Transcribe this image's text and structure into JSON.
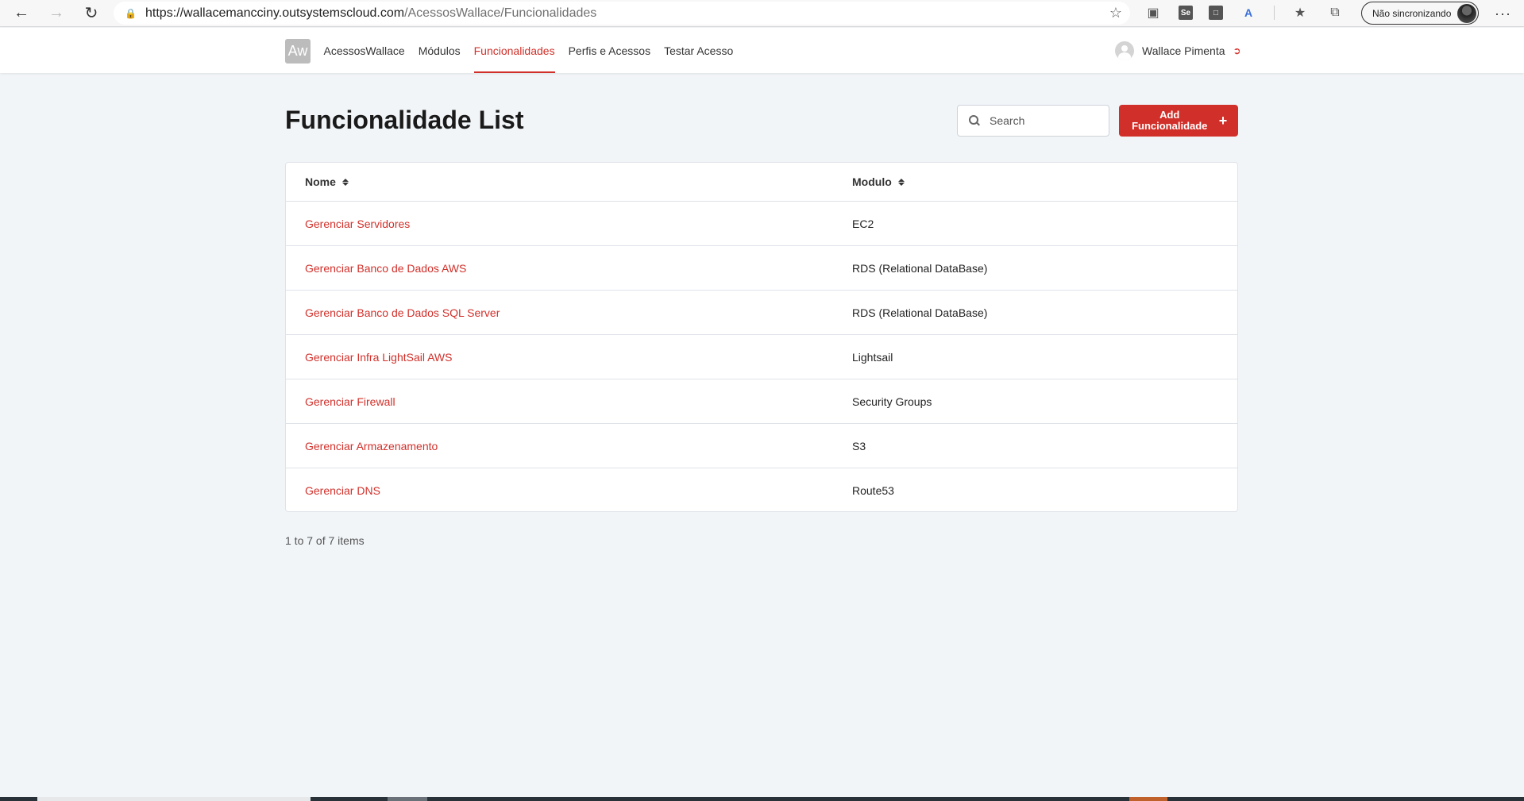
{
  "browser": {
    "url_host": "https://wallacemancciny.outsystemscloud.com",
    "url_path": "/AcessosWallace/Funcionalidades",
    "sync_label": "Não sincronizando",
    "more_label": "···"
  },
  "header": {
    "logo_text": "Aw",
    "menu": [
      {
        "label": "AcessosWallace"
      },
      {
        "label": "Módulos"
      },
      {
        "label": "Funcionalidades"
      },
      {
        "label": "Perfis e Acessos"
      },
      {
        "label": "Testar Acesso"
      }
    ],
    "active_menu": "Funcionalidades",
    "user_name": "Wallace Pimenta"
  },
  "page": {
    "title": "Funcionalidade List",
    "search_placeholder": "Search",
    "add_button_label": "Add Funcionalidade",
    "add_button_icon": "+",
    "columns": {
      "name": "Nome",
      "module": "Modulo"
    },
    "rows": [
      {
        "name": "Gerenciar Servidores",
        "module": "EC2"
      },
      {
        "name": "Gerenciar Banco de Dados AWS",
        "module": "RDS (Relational DataBase)"
      },
      {
        "name": "Gerenciar Banco de Dados SQL Server",
        "module": "RDS (Relational DataBase)"
      },
      {
        "name": "Gerenciar Infra LightSail AWS",
        "module": "Lightsail"
      },
      {
        "name": "Gerenciar Firewall",
        "module": "Security Groups"
      },
      {
        "name": "Gerenciar Armazenamento",
        "module": "S3"
      },
      {
        "name": "Gerenciar DNS",
        "module": "Route53"
      }
    ],
    "count_text": "1 to 7 of 7 items"
  },
  "colors": {
    "accent": "#d1302a",
    "background": "#f2f5f8"
  }
}
